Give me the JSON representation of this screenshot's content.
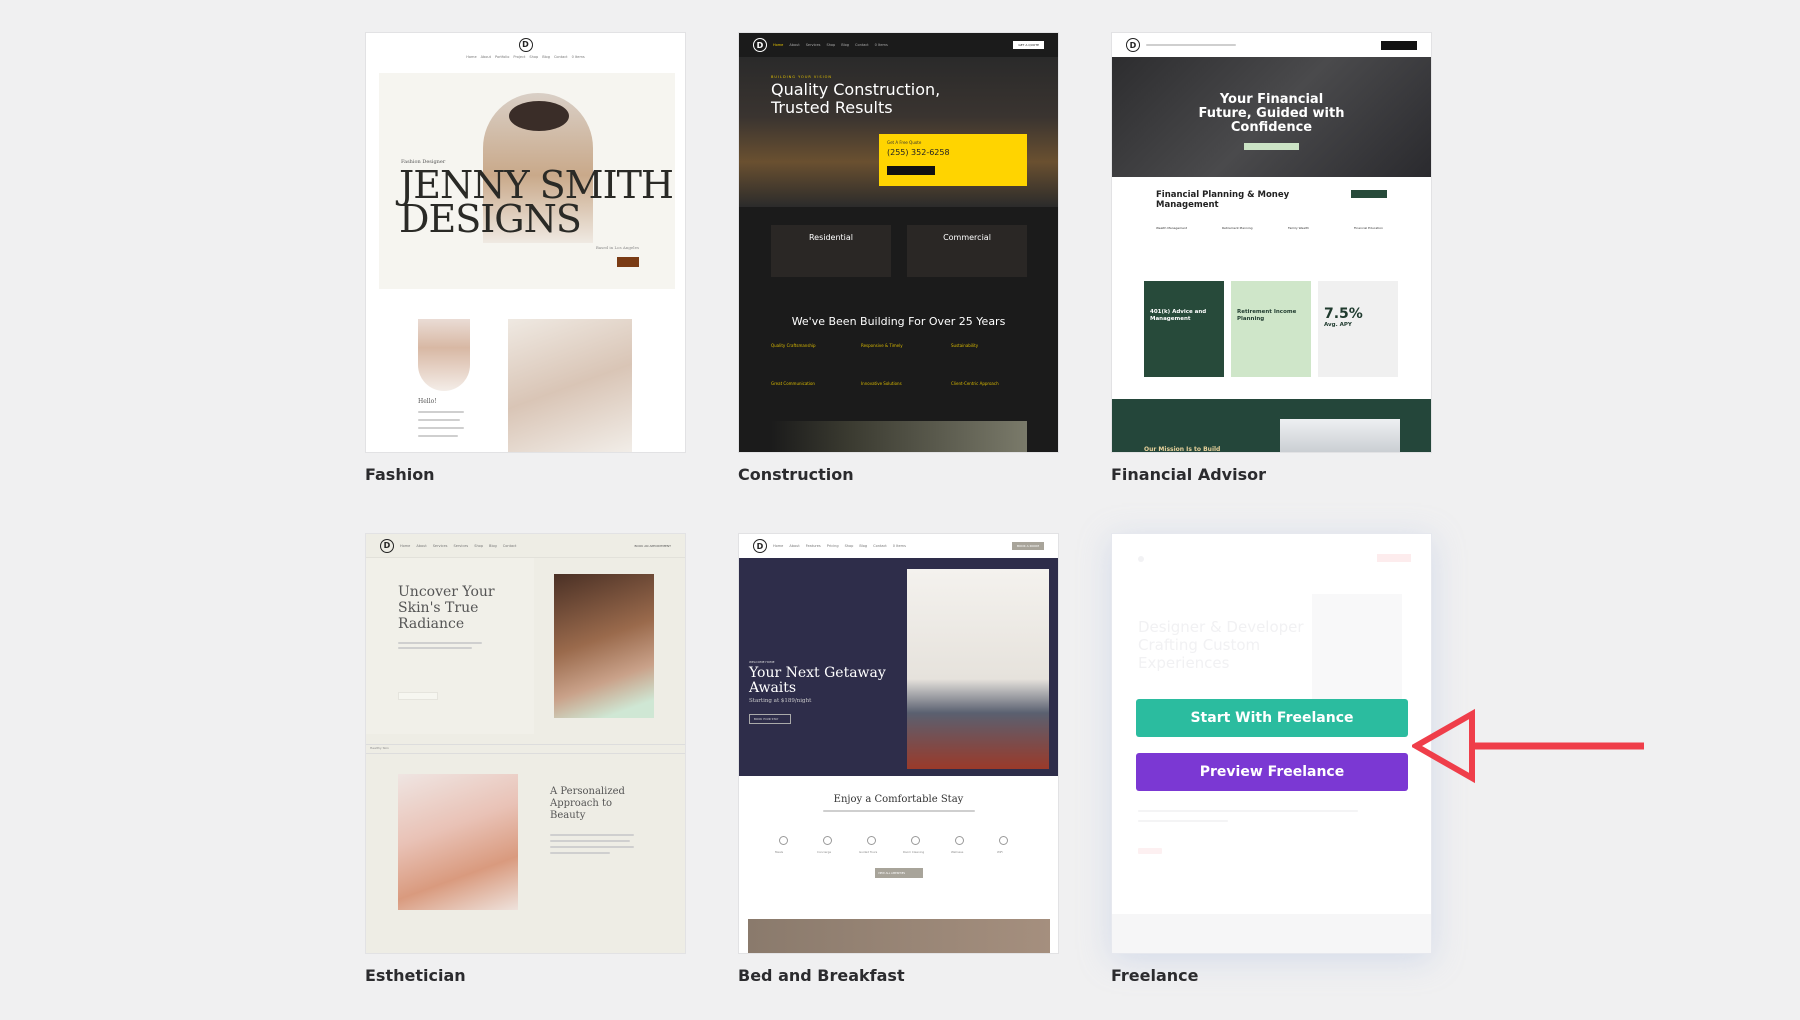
{
  "templates": [
    {
      "id": "fashion",
      "label": "Fashion",
      "preview": {
        "nav": [
          "Home",
          "About",
          "Portfolio",
          "Project",
          "Shop",
          "Blog",
          "Contact",
          "0 Items"
        ],
        "kicker": "Fashion Designer",
        "headline_line1": "JENNY SMITH",
        "headline_line2": "DESIGNS",
        "location": "Based in Los Angeles",
        "hello": "Hello!"
      }
    },
    {
      "id": "construction",
      "label": "Construction",
      "preview": {
        "nav": [
          "Home",
          "About",
          "Services",
          "Shop",
          "Blog",
          "Contact",
          "0 Items"
        ],
        "quote_button": "GET A QUOTE",
        "kicker": "BUILDING YOUR VISION",
        "headline_line1": "Quality Construction,",
        "headline_line2": "Trusted Results",
        "quote_label": "Get A Free Quote",
        "phone": "(255) 352-6258",
        "tiles": [
          "Residential",
          "Commercial"
        ],
        "section_title": "We've Been Building For Over 25 Years",
        "features": [
          "Quality Craftsmanship",
          "Responsive & Timely",
          "Sustainability",
          "Great Communication",
          "Innovative Solutions",
          "Client-Centric Approach"
        ]
      }
    },
    {
      "id": "financial-advisor",
      "label": "Financial Advisor",
      "preview": {
        "headline_line1": "Your Financial",
        "headline_line2": "Future, Guided with",
        "headline_line3": "Confidence",
        "section_title_line1": "Financial Planning & Money",
        "section_title_line2": "Management",
        "columns": [
          "Wealth Management",
          "Retirement Planning",
          "Family Wealth",
          "Financial Education"
        ],
        "boxes": [
          {
            "title": "401(k) Advice and Management"
          },
          {
            "title": "Retirement Income Planning"
          },
          {
            "title": "7.5%",
            "sub": "Avg. APY"
          }
        ],
        "mission": "Our Mission Is to Build"
      }
    },
    {
      "id": "esthetician",
      "label": "Esthetician",
      "preview": {
        "nav": [
          "Home",
          "About",
          "Services",
          "Services",
          "Shop",
          "Blog",
          "Contact"
        ],
        "cta": "BOOK AN APPOINTMENT",
        "headline_line1": "Uncover Your",
        "headline_line2": "Skin's True",
        "headline_line3": "Radiance",
        "ticker": "Healthy Skin",
        "section_line1": "A Personalized",
        "section_line2": "Approach to",
        "section_line3": "Beauty"
      }
    },
    {
      "id": "bed-and-breakfast",
      "label": "Bed and Breakfast",
      "preview": {
        "nav": [
          "Home",
          "About",
          "Features",
          "Pricing",
          "Shop",
          "Blog",
          "Contact",
          "0 Items"
        ],
        "book_button": "BOOK A ROOM",
        "kicker": "WELCOME HOME",
        "headline_line1": "Your Next Getaway",
        "headline_line2": "Awaits",
        "price": "Starting at $189/night",
        "cta": "BOOK YOUR STAY",
        "section_title": "Enjoy a Comfortable Stay",
        "amenities": [
          "Meals",
          "Concierge",
          "Guided Tours",
          "Room Cleaning",
          "Wellness",
          "WiFi"
        ],
        "amenities_button": "VIEW ALL AMENITIES"
      }
    },
    {
      "id": "freelance",
      "label": "Freelance",
      "hovered": true,
      "preview": {
        "headline_line1": "Designer & Developer",
        "headline_line2": "Crafting Custom",
        "headline_line3": "Experiences"
      },
      "actions": {
        "start_label": "Start With Freelance",
        "preview_label": "Preview Freelance"
      }
    }
  ],
  "colors": {
    "start_button": "#2bbc9f",
    "preview_button": "#7b38d3",
    "annotation_arrow": "#ef3e4a",
    "page_background": "#f0f0f1"
  },
  "annotation": {
    "type": "arrow",
    "points_to": "Start With Freelance"
  }
}
